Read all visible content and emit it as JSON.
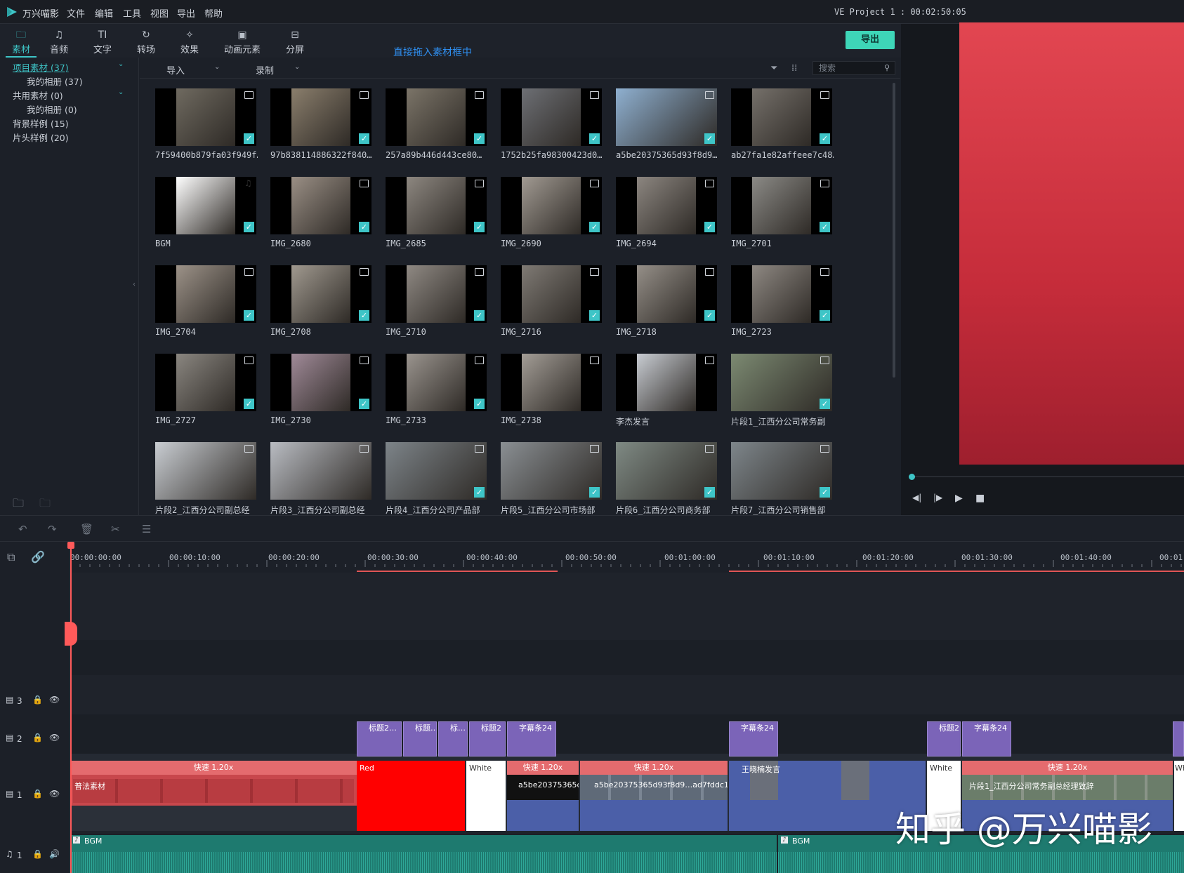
{
  "app": {
    "name": "万兴喵影",
    "menu": [
      "文件",
      "编辑",
      "工具",
      "视图",
      "导出",
      "帮助"
    ],
    "project_status": "VE Project 1 : 00:02:50:05"
  },
  "tabs": [
    {
      "label": "素材",
      "icon": "folder-icon",
      "active": true
    },
    {
      "label": "音频",
      "icon": "music-note-icon"
    },
    {
      "label": "文字",
      "icon": "text-icon"
    },
    {
      "label": "转场",
      "icon": "transition-icon"
    },
    {
      "label": "效果",
      "icon": "effects-icon"
    },
    {
      "label": "动画元素",
      "icon": "elements-icon"
    },
    {
      "label": "分屏",
      "icon": "split-screen-icon"
    }
  ],
  "export_label": "导出",
  "hint_text": "直接拖入素材框中",
  "sidebar": {
    "items": [
      {
        "label": "项目素材 (37)",
        "indent": 0,
        "selected": true,
        "chevron": true
      },
      {
        "label": "我的相册 (37)",
        "indent": 1
      },
      {
        "label": "共用素材 (0)",
        "indent": 0,
        "chevron": true
      },
      {
        "label": "我的相册 (0)",
        "indent": 1
      },
      {
        "label": "背景样例 (15)",
        "indent": 0
      },
      {
        "label": "片头样例 (20)",
        "indent": 0
      }
    ]
  },
  "media_bar": {
    "import_label": "导入",
    "record_label": "录制",
    "search_placeholder": "搜索"
  },
  "media_items": [
    {
      "name": "7f59400b879fa03f949f…",
      "type": "image",
      "checked": true,
      "photo": "#6f6a60"
    },
    {
      "name": "97b838114886322f840…",
      "type": "image",
      "checked": true,
      "photo": "#8a7e6c"
    },
    {
      "name": "257a89b446d443ce80…",
      "type": "image",
      "checked": true,
      "photo": "#7b7468"
    },
    {
      "name": "1752b25fa98300423d0…",
      "type": "image",
      "checked": true,
      "photo": "#6d6f74"
    },
    {
      "name": "a5be20375365d93f8d9…",
      "type": "video",
      "checked": true,
      "photo": "#8fb0d0"
    },
    {
      "name": "ab27fa1e82affeee7c48…",
      "type": "image",
      "checked": true,
      "photo": "#75706a"
    },
    {
      "name": "BGM",
      "type": "audio",
      "checked": true,
      "photo": "#ffffff"
    },
    {
      "name": "IMG_2680",
      "type": "image",
      "checked": true,
      "photo": "#9a8f85"
    },
    {
      "name": "IMG_2685",
      "type": "image",
      "checked": true,
      "photo": "#8d8780"
    },
    {
      "name": "IMG_2690",
      "type": "image",
      "checked": true,
      "photo": "#a19a92"
    },
    {
      "name": "IMG_2694",
      "type": "image",
      "checked": true,
      "photo": "#8c8680"
    },
    {
      "name": "IMG_2701",
      "type": "image",
      "checked": true,
      "photo": "#8b8a86"
    },
    {
      "name": "IMG_2704",
      "type": "image",
      "checked": true,
      "photo": "#9c9288"
    },
    {
      "name": "IMG_2708",
      "type": "image",
      "checked": true,
      "photo": "#a0998f"
    },
    {
      "name": "IMG_2710",
      "type": "image",
      "checked": true,
      "photo": "#8f8983"
    },
    {
      "name": "IMG_2716",
      "type": "image",
      "checked": true,
      "photo": "#7f7a74"
    },
    {
      "name": "IMG_2718",
      "type": "image",
      "checked": true,
      "photo": "#958f88"
    },
    {
      "name": "IMG_2723",
      "type": "image",
      "checked": true,
      "photo": "#8e8882"
    },
    {
      "name": "IMG_2727",
      "type": "image",
      "checked": true,
      "photo": "#8a8680"
    },
    {
      "name": "IMG_2730",
      "type": "image",
      "checked": true,
      "photo": "#a08a98"
    },
    {
      "name": "IMG_2733",
      "type": "image",
      "checked": true,
      "photo": "#9a948e"
    },
    {
      "name": "IMG_2738",
      "type": "image",
      "checked": false,
      "photo": "#a39d96"
    },
    {
      "name": "李杰发言",
      "type": "video",
      "checked": false,
      "photo": "#c8ccd2"
    },
    {
      "name": "片段1_江西分公司常务副",
      "type": "video",
      "checked": true,
      "photo": "#7c8a72"
    },
    {
      "name": "片段2_江西分公司副总经",
      "type": "video",
      "checked": false,
      "photo": "#c9cdd2"
    },
    {
      "name": "片段3_江西分公司副总经",
      "type": "video",
      "checked": false,
      "photo": "#b9bcc2"
    },
    {
      "name": "片段4_江西分公司产品部",
      "type": "video",
      "checked": true,
      "photo": "#7d8489"
    },
    {
      "name": "片段5_江西分公司市场部",
      "type": "video",
      "checked": true,
      "photo": "#8a8f93"
    },
    {
      "name": "片段6_江西分公司商务部",
      "type": "video",
      "checked": true,
      "photo": "#7f8a84"
    },
    {
      "name": "片段7_江西分公司销售部",
      "type": "video",
      "checked": true,
      "photo": "#7e868b"
    }
  ],
  "ruler": [
    "00:00:00:00",
    "00:00:10:00",
    "00:00:20:00",
    "00:00:30:00",
    "00:00:40:00",
    "00:00:50:00",
    "00:01:00:00",
    "00:01:10:00",
    "00:01:20:00",
    "00:01:30:00",
    "00:01:40:00",
    "00:01:"
  ],
  "tracks": {
    "video3": "3",
    "video2": "2",
    "video1": "1",
    "audio1": "1"
  },
  "timeline": {
    "track2_clips": [
      "标题2…",
      "标题…",
      "标…",
      "标题2",
      "字幕条24",
      "字幕条24",
      "标题2",
      "字幕条24"
    ],
    "speed_labels": [
      "快速 1.20x",
      "快速 1.20x",
      "快速 1.20x",
      "快速 1.20x"
    ],
    "track1_clips": {
      "first": "普法素材",
      "red": "Red",
      "white": "White",
      "a5be1": "a5be20375365d9",
      "a5be2": "a5be20375365d93f8d9…ad7fddc1e8",
      "speaker": "王晓楠发言",
      "white2": "White",
      "segment1": "片段1_江西分公司常务副总经理致辞",
      "wh_end": "Wh"
    },
    "audio_clips": [
      "BGM",
      "BGM"
    ]
  },
  "watermark": "知乎 @万兴喵影"
}
